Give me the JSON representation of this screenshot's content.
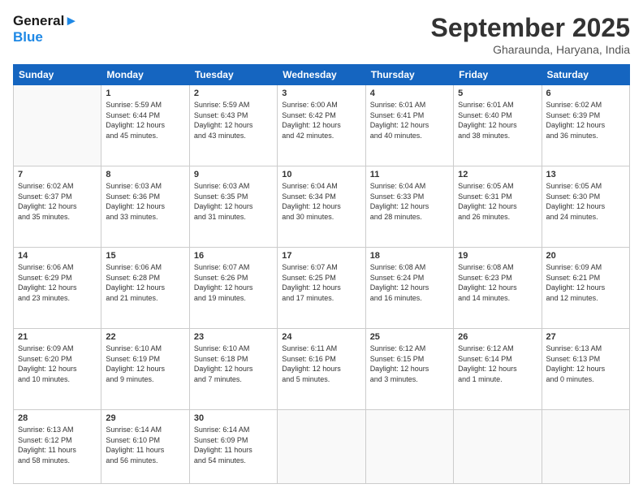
{
  "header": {
    "logo_line1": "General",
    "logo_line2": "Blue",
    "month": "September 2025",
    "location": "Gharaunda, Haryana, India"
  },
  "weekdays": [
    "Sunday",
    "Monday",
    "Tuesday",
    "Wednesday",
    "Thursday",
    "Friday",
    "Saturday"
  ],
  "weeks": [
    [
      {
        "day": "",
        "info": ""
      },
      {
        "day": "1",
        "info": "Sunrise: 5:59 AM\nSunset: 6:44 PM\nDaylight: 12 hours\nand 45 minutes."
      },
      {
        "day": "2",
        "info": "Sunrise: 5:59 AM\nSunset: 6:43 PM\nDaylight: 12 hours\nand 43 minutes."
      },
      {
        "day": "3",
        "info": "Sunrise: 6:00 AM\nSunset: 6:42 PM\nDaylight: 12 hours\nand 42 minutes."
      },
      {
        "day": "4",
        "info": "Sunrise: 6:01 AM\nSunset: 6:41 PM\nDaylight: 12 hours\nand 40 minutes."
      },
      {
        "day": "5",
        "info": "Sunrise: 6:01 AM\nSunset: 6:40 PM\nDaylight: 12 hours\nand 38 minutes."
      },
      {
        "day": "6",
        "info": "Sunrise: 6:02 AM\nSunset: 6:39 PM\nDaylight: 12 hours\nand 36 minutes."
      }
    ],
    [
      {
        "day": "7",
        "info": "Sunrise: 6:02 AM\nSunset: 6:37 PM\nDaylight: 12 hours\nand 35 minutes."
      },
      {
        "day": "8",
        "info": "Sunrise: 6:03 AM\nSunset: 6:36 PM\nDaylight: 12 hours\nand 33 minutes."
      },
      {
        "day": "9",
        "info": "Sunrise: 6:03 AM\nSunset: 6:35 PM\nDaylight: 12 hours\nand 31 minutes."
      },
      {
        "day": "10",
        "info": "Sunrise: 6:04 AM\nSunset: 6:34 PM\nDaylight: 12 hours\nand 30 minutes."
      },
      {
        "day": "11",
        "info": "Sunrise: 6:04 AM\nSunset: 6:33 PM\nDaylight: 12 hours\nand 28 minutes."
      },
      {
        "day": "12",
        "info": "Sunrise: 6:05 AM\nSunset: 6:31 PM\nDaylight: 12 hours\nand 26 minutes."
      },
      {
        "day": "13",
        "info": "Sunrise: 6:05 AM\nSunset: 6:30 PM\nDaylight: 12 hours\nand 24 minutes."
      }
    ],
    [
      {
        "day": "14",
        "info": "Sunrise: 6:06 AM\nSunset: 6:29 PM\nDaylight: 12 hours\nand 23 minutes."
      },
      {
        "day": "15",
        "info": "Sunrise: 6:06 AM\nSunset: 6:28 PM\nDaylight: 12 hours\nand 21 minutes."
      },
      {
        "day": "16",
        "info": "Sunrise: 6:07 AM\nSunset: 6:26 PM\nDaylight: 12 hours\nand 19 minutes."
      },
      {
        "day": "17",
        "info": "Sunrise: 6:07 AM\nSunset: 6:25 PM\nDaylight: 12 hours\nand 17 minutes."
      },
      {
        "day": "18",
        "info": "Sunrise: 6:08 AM\nSunset: 6:24 PM\nDaylight: 12 hours\nand 16 minutes."
      },
      {
        "day": "19",
        "info": "Sunrise: 6:08 AM\nSunset: 6:23 PM\nDaylight: 12 hours\nand 14 minutes."
      },
      {
        "day": "20",
        "info": "Sunrise: 6:09 AM\nSunset: 6:21 PM\nDaylight: 12 hours\nand 12 minutes."
      }
    ],
    [
      {
        "day": "21",
        "info": "Sunrise: 6:09 AM\nSunset: 6:20 PM\nDaylight: 12 hours\nand 10 minutes."
      },
      {
        "day": "22",
        "info": "Sunrise: 6:10 AM\nSunset: 6:19 PM\nDaylight: 12 hours\nand 9 minutes."
      },
      {
        "day": "23",
        "info": "Sunrise: 6:10 AM\nSunset: 6:18 PM\nDaylight: 12 hours\nand 7 minutes."
      },
      {
        "day": "24",
        "info": "Sunrise: 6:11 AM\nSunset: 6:16 PM\nDaylight: 12 hours\nand 5 minutes."
      },
      {
        "day": "25",
        "info": "Sunrise: 6:12 AM\nSunset: 6:15 PM\nDaylight: 12 hours\nand 3 minutes."
      },
      {
        "day": "26",
        "info": "Sunrise: 6:12 AM\nSunset: 6:14 PM\nDaylight: 12 hours\nand 1 minute."
      },
      {
        "day": "27",
        "info": "Sunrise: 6:13 AM\nSunset: 6:13 PM\nDaylight: 12 hours\nand 0 minutes."
      }
    ],
    [
      {
        "day": "28",
        "info": "Sunrise: 6:13 AM\nSunset: 6:12 PM\nDaylight: 11 hours\nand 58 minutes."
      },
      {
        "day": "29",
        "info": "Sunrise: 6:14 AM\nSunset: 6:10 PM\nDaylight: 11 hours\nand 56 minutes."
      },
      {
        "day": "30",
        "info": "Sunrise: 6:14 AM\nSunset: 6:09 PM\nDaylight: 11 hours\nand 54 minutes."
      },
      {
        "day": "",
        "info": ""
      },
      {
        "day": "",
        "info": ""
      },
      {
        "day": "",
        "info": ""
      },
      {
        "day": "",
        "info": ""
      }
    ]
  ]
}
